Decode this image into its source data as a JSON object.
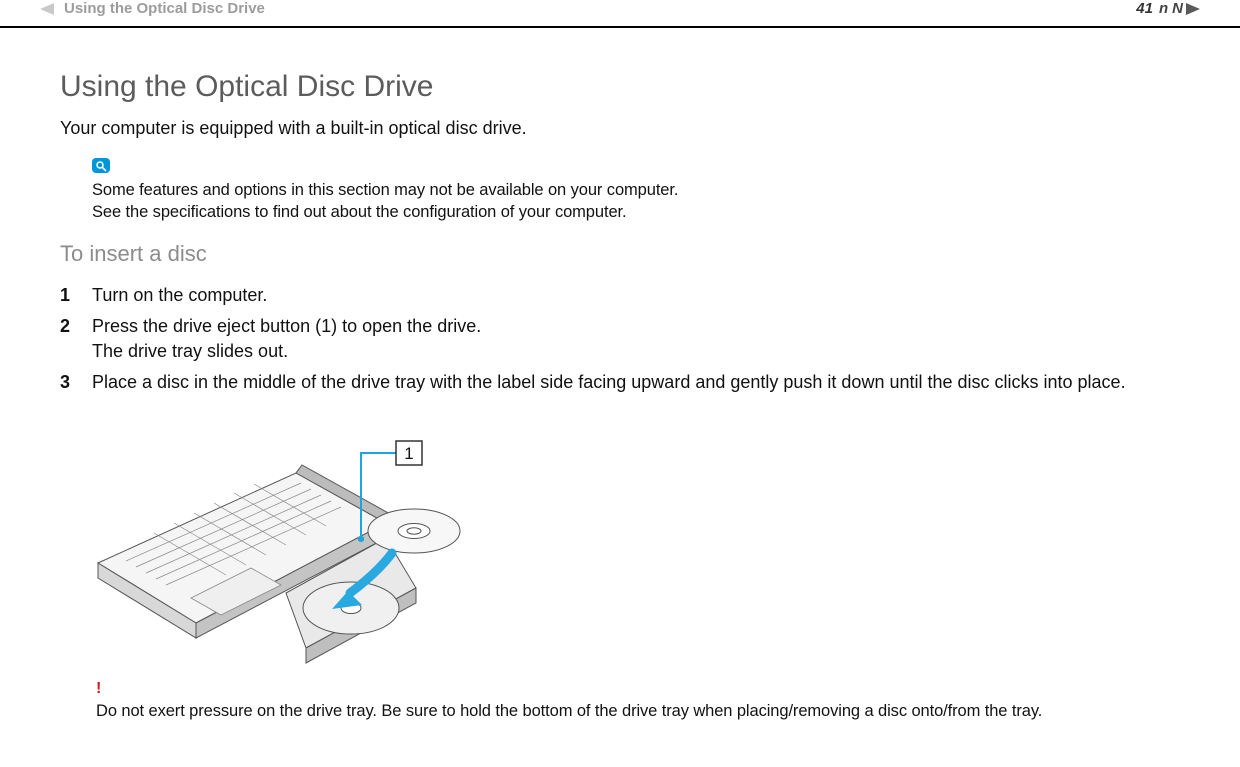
{
  "header": {
    "section_title": "Using the Optical Disc Drive",
    "nn_label": "n N",
    "page_number": "41"
  },
  "main": {
    "title": "Using the Optical Disc Drive",
    "intro": "Your computer is equipped with a built-in optical disc drive.",
    "note": {
      "line1": "Some features and options in this section may not be available on your computer.",
      "line2": "See the specifications to find out about the configuration of your computer."
    },
    "subheading": "To insert a disc",
    "steps": [
      {
        "num": "1",
        "text": "Turn on the computer."
      },
      {
        "num": "2",
        "text": "Press the drive eject button (1) to open the drive.",
        "sub": "The drive tray slides out."
      },
      {
        "num": "3",
        "text": "Place a disc in the middle of the drive tray with the label side facing upward and gently push it down until the disc clicks into place."
      }
    ],
    "illustration": {
      "callout_label": "1"
    },
    "warning": {
      "mark": "!",
      "text": "Do not exert pressure on the drive tray. Be sure to hold the bottom of the drive tray when placing/removing a disc onto/from the tray."
    }
  }
}
